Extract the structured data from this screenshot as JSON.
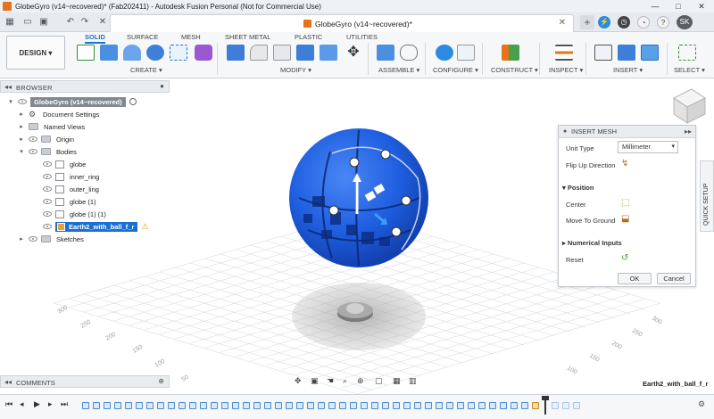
{
  "window": {
    "title": "GlobeGyro (v14~recovered)* (Fab202411) - Autodesk Fusion Personal (Not for Commercial Use)",
    "controls": [
      "—",
      "□",
      "✕"
    ]
  },
  "document_tab": {
    "title": "GlobeGyro (v14~recovered)*",
    "close": "✕"
  },
  "account": {
    "initials": "SK"
  },
  "workspace": {
    "label": "DESIGN ▾"
  },
  "ribbon_tabs": [
    {
      "label": "SOLID",
      "active": true
    },
    {
      "label": "SURFACE"
    },
    {
      "label": "MESH"
    },
    {
      "label": "SHEET METAL"
    },
    {
      "label": "PLASTIC"
    },
    {
      "label": "UTILITIES"
    }
  ],
  "ribbon_groups": {
    "create": "CREATE ▾",
    "modify": "MODIFY ▾",
    "assemble": "ASSEMBLE ▾",
    "configure": "CONFIGURE ▾",
    "construct": "CONSTRUCT ▾",
    "inspect": "INSPECT ▾",
    "insert": "INSERT ▾",
    "select": "SELECT ▾"
  },
  "browser": {
    "title": "BROWSER",
    "root": "GlobeGyro (v14~recovered)",
    "items": [
      {
        "label": "Document Settings"
      },
      {
        "label": "Named Views"
      },
      {
        "label": "Origin"
      },
      {
        "label": "Bodies"
      }
    ],
    "bodies": [
      {
        "label": "globe"
      },
      {
        "label": "inner_ring"
      },
      {
        "label": "outer_ling"
      },
      {
        "label": "globe (1)"
      },
      {
        "label": "globe (1) (1)"
      },
      {
        "label": "Earth2_with_ball_f_r",
        "selected": true
      }
    ],
    "sketches": "Sketches"
  },
  "insert_mesh": {
    "title": "INSERT MESH",
    "unit_type_label": "Unit Type",
    "unit_type_value": "Millimeter",
    "flip_up_label": "Flip Up Direction",
    "position_section": "Position",
    "center_label": "Center",
    "move_to_ground_label": "Move To Ground",
    "numerical_section": "Numerical Inputs",
    "reset_label": "Reset",
    "ok": "OK",
    "cancel": "Cancel"
  },
  "quick_setup": "QUICK SETUP",
  "comments": {
    "title": "COMMENTS"
  },
  "status_name": "Earth2_with_ball_f_r",
  "grid_labels": [
    "300",
    "250",
    "200",
    "150",
    "100",
    "50"
  ],
  "colors": {
    "accent": "#1a73c9",
    "mesh_blue": "#1f5fe0",
    "selected_bg": "#1b6fd2",
    "brand_orange": "#e8731b"
  }
}
